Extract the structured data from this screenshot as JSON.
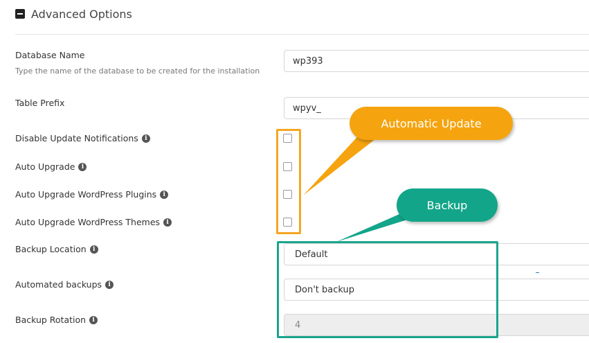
{
  "section": {
    "title": "Advanced Options"
  },
  "database": {
    "label": "Database Name",
    "hint": "Type the name of the database to be created for the installation",
    "value": "wp393"
  },
  "table_prefix": {
    "label": "Table Prefix",
    "value": "wpyv_"
  },
  "options": {
    "disable_update_notifications": {
      "label": "Disable Update Notifications",
      "checked": false
    },
    "auto_upgrade": {
      "label": "Auto Upgrade",
      "checked": false
    },
    "auto_upgrade_plugins": {
      "label": "Auto Upgrade WordPress Plugins",
      "checked": false
    },
    "auto_upgrade_themes": {
      "label": "Auto Upgrade WordPress Themes",
      "checked": false
    }
  },
  "backup_location": {
    "label": "Backup Location",
    "value": "Default"
  },
  "automated_backups": {
    "label": "Automated backups",
    "value": "Don't backup"
  },
  "backup_rotation": {
    "label": "Backup Rotation",
    "value": "4",
    "disabled": true
  },
  "annotations": {
    "automatic_update": {
      "text": "Automatic Update",
      "color": "#f5a623"
    },
    "backup": {
      "text": "Backup",
      "color": "#1aa58c"
    }
  },
  "icons": {
    "collapse": "minus-square-icon",
    "info": "info-circle-icon"
  }
}
